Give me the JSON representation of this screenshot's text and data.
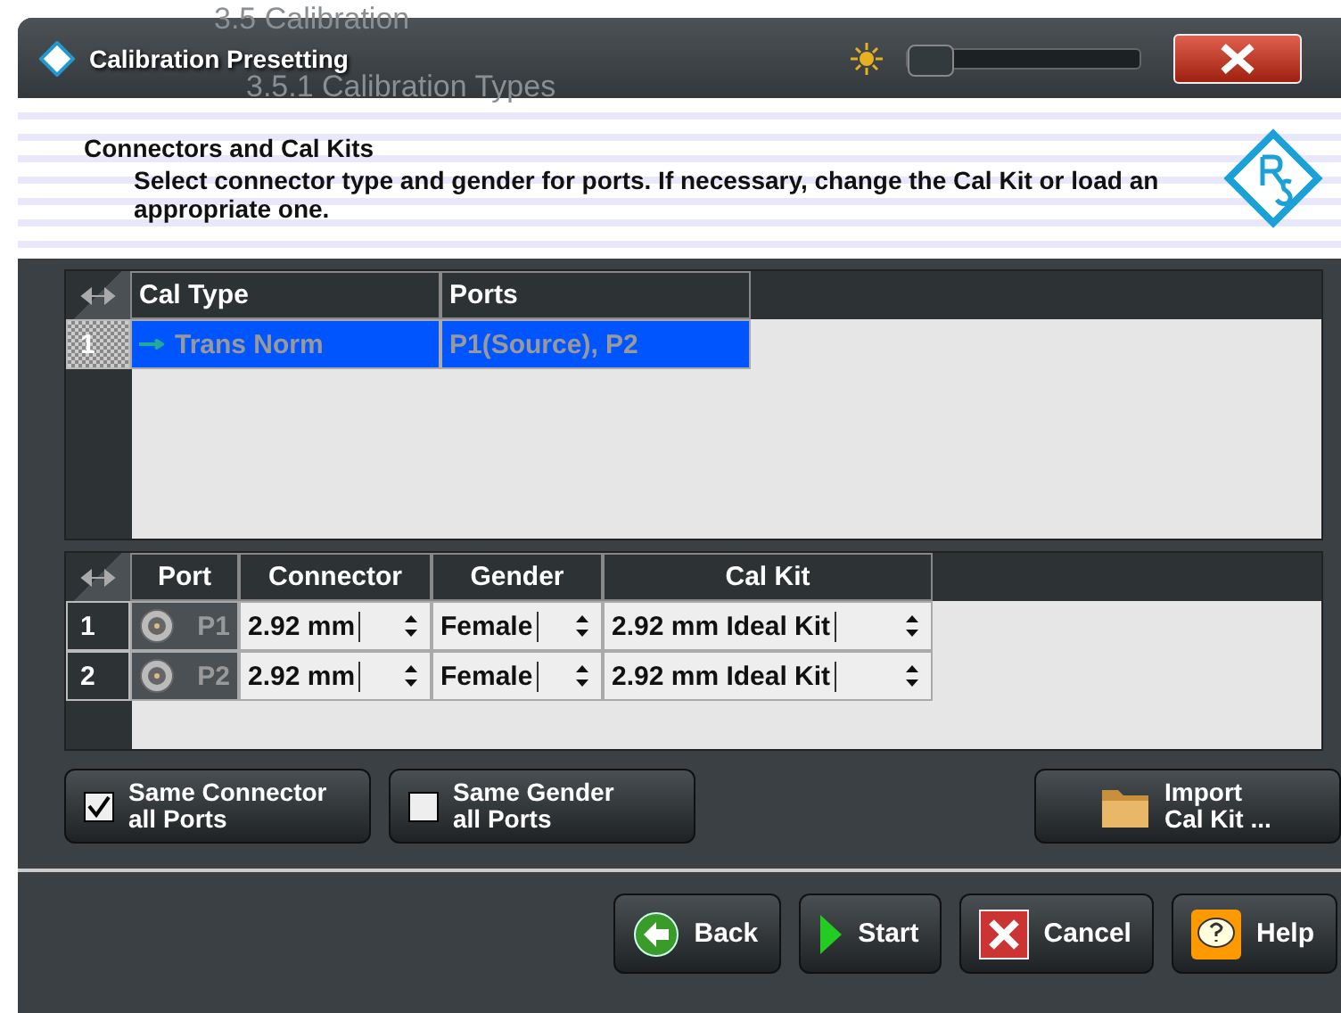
{
  "background_document": {
    "headings": [
      "3.5 Calibration",
      "3.5.1 Calibration Types"
    ]
  },
  "window": {
    "title": "Calibration Presetting",
    "brightness": {
      "level": 0
    }
  },
  "header": {
    "title": "Connectors and Cal Kits",
    "description": "Select connector type and gender for ports. If necessary, change the Cal Kit or load an appropriate one."
  },
  "cal_table": {
    "columns": [
      "Cal Type",
      "Ports"
    ],
    "rows": [
      {
        "index": "1",
        "cal_type": "Trans Norm",
        "ports": "P1(Source), P2",
        "selected": true
      }
    ]
  },
  "port_table": {
    "columns": [
      "Port",
      "Connector",
      "Gender",
      "Cal Kit"
    ],
    "rows": [
      {
        "index": "1",
        "port": "P1",
        "connector": "2.92 mm",
        "gender": "Female",
        "cal_kit": "2.92 mm Ideal Kit"
      },
      {
        "index": "2",
        "port": "P2",
        "connector": "2.92 mm",
        "gender": "Female",
        "cal_kit": "2.92 mm Ideal Kit"
      }
    ]
  },
  "options": [
    {
      "label": "Same Connector\nall Ports",
      "checked": true
    },
    {
      "label": "Same Gender\nall Ports",
      "checked": false
    }
  ],
  "import_button": {
    "label": "Import\nCal Kit ..."
  },
  "buttons": [
    {
      "kind": "back",
      "label": "Back"
    },
    {
      "kind": "start",
      "label": "Start"
    },
    {
      "kind": "cancel",
      "label": "Cancel"
    },
    {
      "kind": "help",
      "label": "Help"
    }
  ]
}
